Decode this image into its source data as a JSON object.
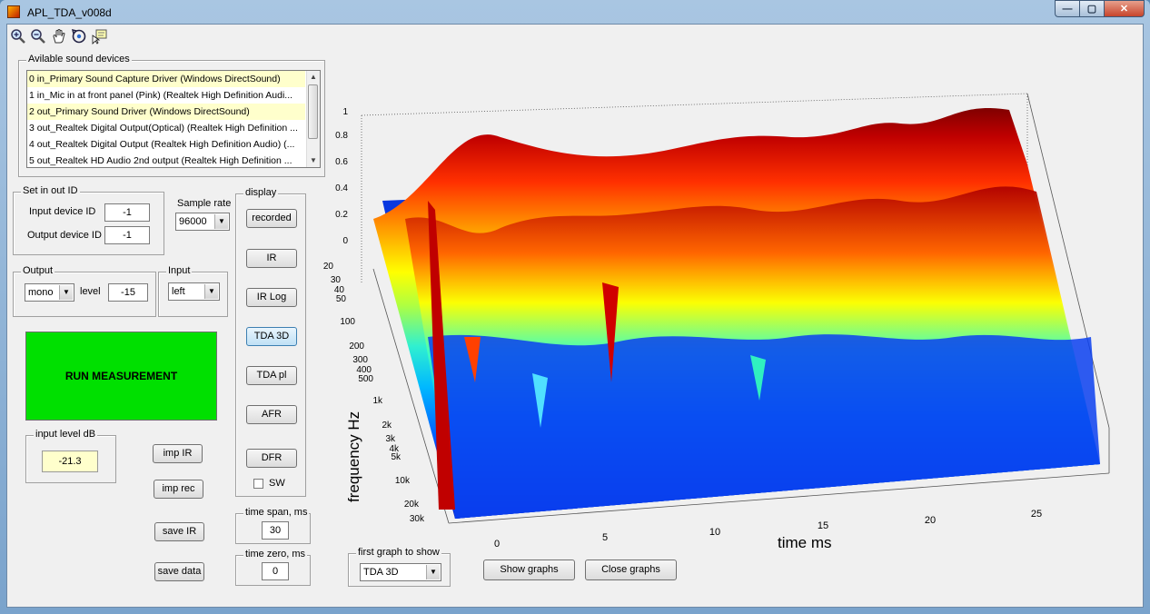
{
  "window": {
    "title": "APL_TDA_v008d",
    "min_label": "—",
    "max_label": "▢",
    "close_label": "✕"
  },
  "toolbar": {
    "tools": [
      {
        "name": "zoom-in-icon"
      },
      {
        "name": "zoom-out-icon"
      },
      {
        "name": "pan-hand-icon"
      },
      {
        "name": "rotate-3d-icon"
      },
      {
        "name": "data-cursor-icon"
      }
    ]
  },
  "devices": {
    "title": "Avilable sound devices",
    "items": [
      "0 in_Primary Sound Capture Driver (Windows DirectSound)",
      "1 in_Mic in at front panel (Pink) (Realtek High Definition Audi...",
      "2 out_Primary Sound Driver (Windows DirectSound)",
      "3 out_Realtek Digital Output(Optical) (Realtek High Definition ...",
      "4 out_Realtek Digital Output (Realtek High Definition Audio) (...",
      "5 out_Realtek HD Audio 2nd output (Realtek High Definition ..."
    ]
  },
  "inout": {
    "title": "Set in out ID",
    "input_label": "Input device ID",
    "input_value": "-1",
    "output_label": "Output device ID",
    "output_value": "-1"
  },
  "sample_rate": {
    "label": "Sample rate",
    "value": "96000"
  },
  "output": {
    "title": "Output",
    "mode": "mono",
    "level_label": "level",
    "level_value": "-15"
  },
  "input": {
    "title": "Input",
    "channel": "left"
  },
  "run_label": "RUN MEASUREMENT",
  "input_level": {
    "title": "input level dB",
    "value": "-21.3"
  },
  "buttons": {
    "imp_ir": "imp IR",
    "imp_rec": "imp rec",
    "save_ir": "save IR",
    "save_data": "save data"
  },
  "display": {
    "title": "display",
    "buttons": [
      "recorded",
      "IR",
      "IR Log",
      "TDA 3D",
      "TDA pl",
      "AFR",
      "DFR"
    ],
    "sw_label": "SW"
  },
  "time_span": {
    "title": "time span, ms",
    "value": "30"
  },
  "time_zero": {
    "title": "time zero, ms",
    "value": "0"
  },
  "first_graph": {
    "title": "first graph to show",
    "value": "TDA 3D"
  },
  "show_graphs": "Show graphs",
  "close_graphs": "Close graphs",
  "plot": {
    "z_ticks": [
      "0",
      "0.2",
      "0.4",
      "0.6",
      "0.8",
      "1"
    ],
    "freq_ticks": [
      "20",
      "30",
      "40",
      "50",
      "100",
      "200",
      "300",
      "400",
      "500",
      "1k",
      "2k",
      "3k",
      "4k",
      "5k",
      "10k",
      "20k",
      "30k"
    ],
    "time_ticks": [
      "0",
      "5",
      "10",
      "15",
      "20",
      "25"
    ],
    "ylabel": "frequency  Hz",
    "xlabel": "time  ms"
  },
  "colors": {
    "run_bg": "#00e000",
    "highlight": "#ffffcc"
  }
}
